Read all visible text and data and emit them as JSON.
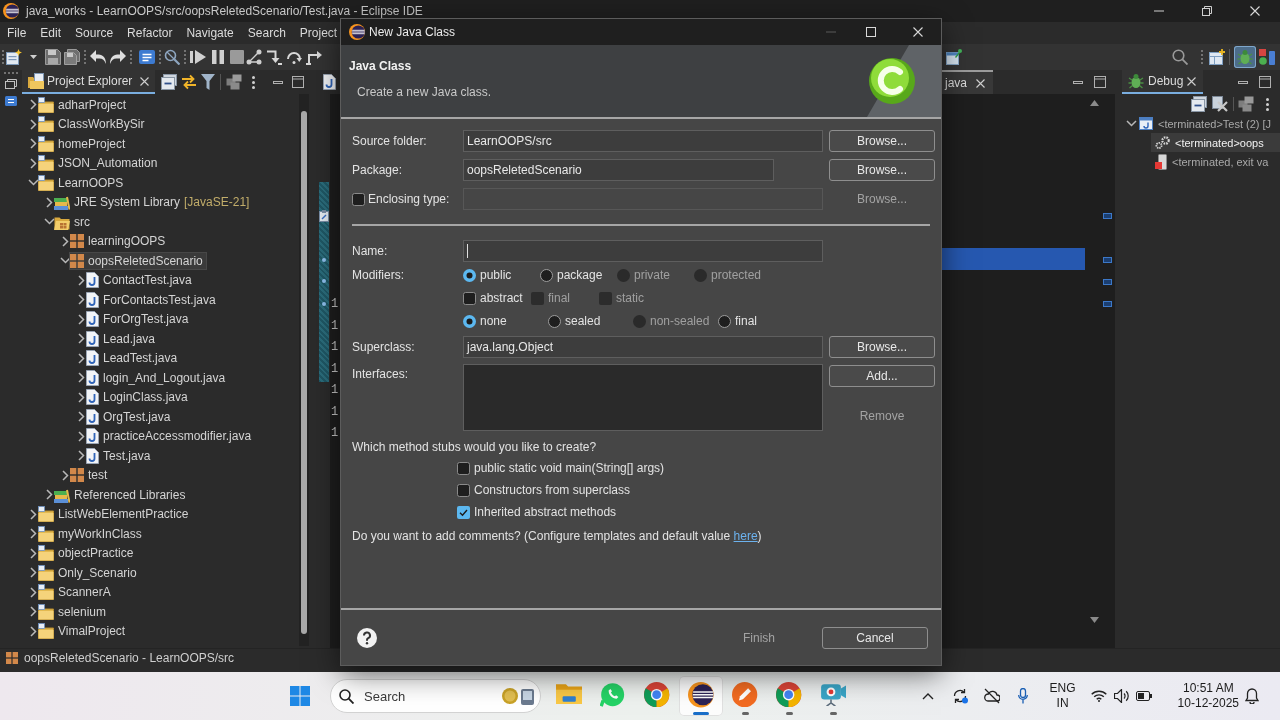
{
  "window": {
    "title": "java_works - LearnOOPS/src/oopsReletedScenario/Test.java - Eclipse IDE"
  },
  "menu": [
    "File",
    "Edit",
    "Source",
    "Refactor",
    "Navigate",
    "Search",
    "Project"
  ],
  "toolbar": {
    "perspectives": [
      {
        "kind": "debug",
        "selected": true
      },
      {
        "kind": "java",
        "selected": false
      }
    ]
  },
  "project_explorer": {
    "title": "Project Explorer",
    "tree": [
      {
        "label": "adharProject",
        "kind": "project",
        "expanded": false,
        "selected": false
      },
      {
        "label": "ClassWorkBySir",
        "kind": "project",
        "expanded": false,
        "selected": false
      },
      {
        "label": "homeProject",
        "kind": "project",
        "expanded": false,
        "selected": false
      },
      {
        "label": "JSON_Automation",
        "kind": "project",
        "expanded": false,
        "selected": false
      },
      {
        "label": "LearnOOPS",
        "kind": "project",
        "expanded": true,
        "selected": false,
        "children": [
          {
            "label": "JRE System Library",
            "decoration": "[JavaSE-21]",
            "kind": "library",
            "expanded": false,
            "selected": false
          },
          {
            "label": "src",
            "kind": "source_folder",
            "expanded": true,
            "selected": false,
            "children": [
              {
                "label": "learningOOPS",
                "kind": "package",
                "expanded": false,
                "selected": false
              },
              {
                "label": "oopsReletedScenario",
                "kind": "package",
                "expanded": true,
                "selected": true,
                "children": [
                  {
                    "label": "ContactTest.java",
                    "kind": "file",
                    "expanded": false,
                    "selected": false
                  },
                  {
                    "label": "ForContactsTest.java",
                    "kind": "file",
                    "expanded": false,
                    "selected": false
                  },
                  {
                    "label": "ForOrgTest.java",
                    "kind": "file",
                    "expanded": false,
                    "selected": false
                  },
                  {
                    "label": "Lead.java",
                    "kind": "file",
                    "expanded": false,
                    "selected": false
                  },
                  {
                    "label": "LeadTest.java",
                    "kind": "file",
                    "expanded": false,
                    "selected": false
                  },
                  {
                    "label": "login_And_Logout.java",
                    "kind": "file",
                    "expanded": false,
                    "selected": false
                  },
                  {
                    "label": "LoginClass.java",
                    "kind": "file",
                    "expanded": false,
                    "selected": false
                  },
                  {
                    "label": "OrgTest.java",
                    "kind": "file",
                    "expanded": false,
                    "selected": false
                  },
                  {
                    "label": "practiceAccessmodifier.java",
                    "kind": "file",
                    "expanded": false,
                    "selected": false
                  },
                  {
                    "label": "Test.java",
                    "kind": "file",
                    "expanded": false,
                    "selected": false
                  }
                ]
              },
              {
                "label": "test",
                "kind": "package",
                "expanded": false,
                "selected": false
              }
            ]
          },
          {
            "label": "Referenced Libraries",
            "kind": "library",
            "expanded": false,
            "selected": false
          }
        ]
      },
      {
        "label": "ListWebElementPractice",
        "kind": "project",
        "expanded": false,
        "selected": false
      },
      {
        "label": "myWorkInClass",
        "kind": "project",
        "expanded": false,
        "selected": false
      },
      {
        "label": "objectPractice",
        "kind": "project",
        "expanded": false,
        "selected": false
      },
      {
        "label": "Only_Scenario",
        "kind": "project",
        "expanded": false,
        "selected": false
      },
      {
        "label": "ScannerA",
        "kind": "project",
        "expanded": false,
        "selected": false
      },
      {
        "label": "selenium",
        "kind": "project",
        "expanded": false,
        "selected": false
      },
      {
        "label": "VimalProject",
        "kind": "project",
        "expanded": false,
        "selected": false
      }
    ]
  },
  "editor": {
    "tab": "java",
    "line_numbers": [
      "1",
      "1",
      "1",
      "1",
      "1",
      "1",
      "1"
    ]
  },
  "debug": {
    "title": "Debug",
    "tree": [
      {
        "label": "<terminated>Test (2) [J",
        "kind": "launch",
        "expanded": true,
        "selected": false,
        "children": [
          {
            "label": "<terminated>oops",
            "kind": "process",
            "selected": true
          },
          {
            "label": "<terminated, exit va",
            "kind": "console",
            "selected": false
          }
        ]
      }
    ]
  },
  "status_bar": "oopsReletedScenario - LearnOOPS/src",
  "dialog": {
    "title": "New Java Class",
    "heading": "Java Class",
    "description": "Create a new Java class.",
    "source_folder": {
      "label": "Source folder:",
      "value": "LearnOOPS/src",
      "button": {
        "label": "Browse...",
        "disabled": false
      }
    },
    "package": {
      "label": "Package:",
      "value": "oopsReletedScenario",
      "button": {
        "label": "Browse...",
        "disabled": false
      }
    },
    "enclosing_type": {
      "label": "Enclosing type:",
      "checked": false,
      "button": {
        "label": "Browse...",
        "disabled": true
      }
    },
    "name": {
      "label": "Name:",
      "focused": true
    },
    "modifiers": {
      "label": "Modifiers:",
      "groups": [
        {
          "kind": "radio",
          "options": [
            {
              "label": "public",
              "selected": true,
              "disabled": false
            },
            {
              "label": "package",
              "selected": false,
              "disabled": false
            },
            {
              "label": "private",
              "selected": false,
              "disabled": true
            },
            {
              "label": "protected",
              "selected": false,
              "disabled": true
            }
          ]
        },
        {
          "kind": "checkbox",
          "options": [
            {
              "label": "abstract",
              "checked": false,
              "disabled": false
            },
            {
              "label": "final",
              "checked": false,
              "disabled": true
            },
            {
              "label": "static",
              "checked": false,
              "disabled": true
            }
          ]
        },
        {
          "kind": "radio",
          "options": [
            {
              "label": "none",
              "selected": true,
              "disabled": false
            },
            {
              "label": "sealed",
              "selected": false,
              "disabled": false
            },
            {
              "label": "non-sealed",
              "selected": false,
              "disabled": true
            },
            {
              "label": "final",
              "selected": false,
              "disabled": false
            }
          ]
        }
      ]
    },
    "superclass": {
      "label": "Superclass:",
      "value": "java.lang.Object",
      "button": {
        "label": "Browse...",
        "disabled": false
      }
    },
    "interfaces": {
      "label": "Interfaces:",
      "buttons": [
        {
          "label": "Add...",
          "disabled": false
        },
        {
          "label": "Remove",
          "disabled": true
        }
      ]
    },
    "stubs": {
      "question": "Which method stubs would you like to create?",
      "options": [
        {
          "label": "public static void main(String[] args)",
          "checked": false
        },
        {
          "label": "Constructors from superclass",
          "checked": false
        },
        {
          "label": "Inherited abstract methods",
          "checked": true
        }
      ]
    },
    "comments": {
      "text": "Do you want to add comments? (Configure templates and default value ",
      "link": "here",
      "suffix": ")"
    },
    "buttons": [
      {
        "label": "Finish",
        "disabled": true
      },
      {
        "label": "Cancel",
        "disabled": false
      }
    ]
  },
  "taskbar": {
    "search": {
      "placeholder": "Search"
    },
    "apps": [
      {
        "kind": "folder",
        "running": false,
        "active": false
      },
      {
        "kind": "chat",
        "running": false,
        "active": false
      },
      {
        "kind": "browser",
        "running": false,
        "active": false
      },
      {
        "kind": "ide",
        "running": true,
        "active": true
      },
      {
        "kind": "pen",
        "running": true,
        "active": false
      },
      {
        "kind": "browser",
        "running": true,
        "active": false
      },
      {
        "kind": "camera",
        "running": true,
        "active": false
      }
    ],
    "language": [
      "ENG",
      "IN"
    ],
    "time": "10:51 AM",
    "date": "10-12-2025"
  }
}
